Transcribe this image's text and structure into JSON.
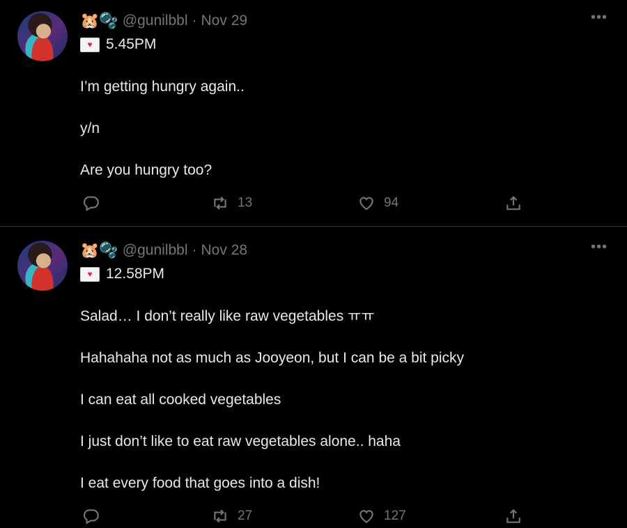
{
  "tweets": [
    {
      "handle": "@gunilbbl",
      "date": "Nov 29",
      "name_emojis": "🐹🫧",
      "time": "5.45PM",
      "lines": [
        "I’m getting hungry again..",
        "y/n",
        "Are you hungry too?"
      ],
      "retweets": "13",
      "likes": "94"
    },
    {
      "handle": "@gunilbbl",
      "date": "Nov 28",
      "name_emojis": "🐹🫧",
      "time": "12.58PM",
      "lines": [
        "Salad… I don’t really like raw vegetables ㅠㅠ",
        "Hahahaha not as much as Jooyeon, but I can be a bit picky",
        "I can eat all cooked vegetables",
        "I just don’t like to eat raw vegetables alone.. haha",
        "I eat every food that goes into a dish!"
      ],
      "retweets": "27",
      "likes": "127"
    }
  ],
  "separator": "·",
  "icons": {
    "reply": "reply-icon",
    "retweet": "retweet-icon",
    "like": "heart-icon",
    "share": "share-icon",
    "more": "more-icon",
    "envelope": "love-letter-icon"
  }
}
